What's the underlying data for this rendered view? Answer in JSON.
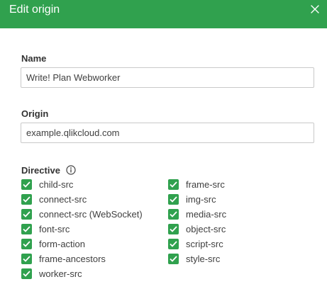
{
  "dialog": {
    "title": "Edit origin",
    "accent_color": "#30A14E"
  },
  "name_field": {
    "label": "Name",
    "value": "Write! Plan Webworker"
  },
  "origin_field": {
    "label": "Origin",
    "value": "example.qlikcloud.com"
  },
  "directive": {
    "label": "Directive",
    "info_icon": "info-circle-icon",
    "items": [
      {
        "label": "child-src",
        "checked": true
      },
      {
        "label": "connect-src",
        "checked": true
      },
      {
        "label": "connect-src (WebSocket)",
        "checked": true
      },
      {
        "label": "font-src",
        "checked": true
      },
      {
        "label": "form-action",
        "checked": true
      },
      {
        "label": "frame-ancestors",
        "checked": true
      },
      {
        "label": "worker-src",
        "checked": true
      },
      {
        "label": "frame-src",
        "checked": true
      },
      {
        "label": "img-src",
        "checked": true
      },
      {
        "label": "media-src",
        "checked": true
      },
      {
        "label": "object-src",
        "checked": true
      },
      {
        "label": "script-src",
        "checked": true
      },
      {
        "label": "style-src",
        "checked": true
      }
    ]
  }
}
